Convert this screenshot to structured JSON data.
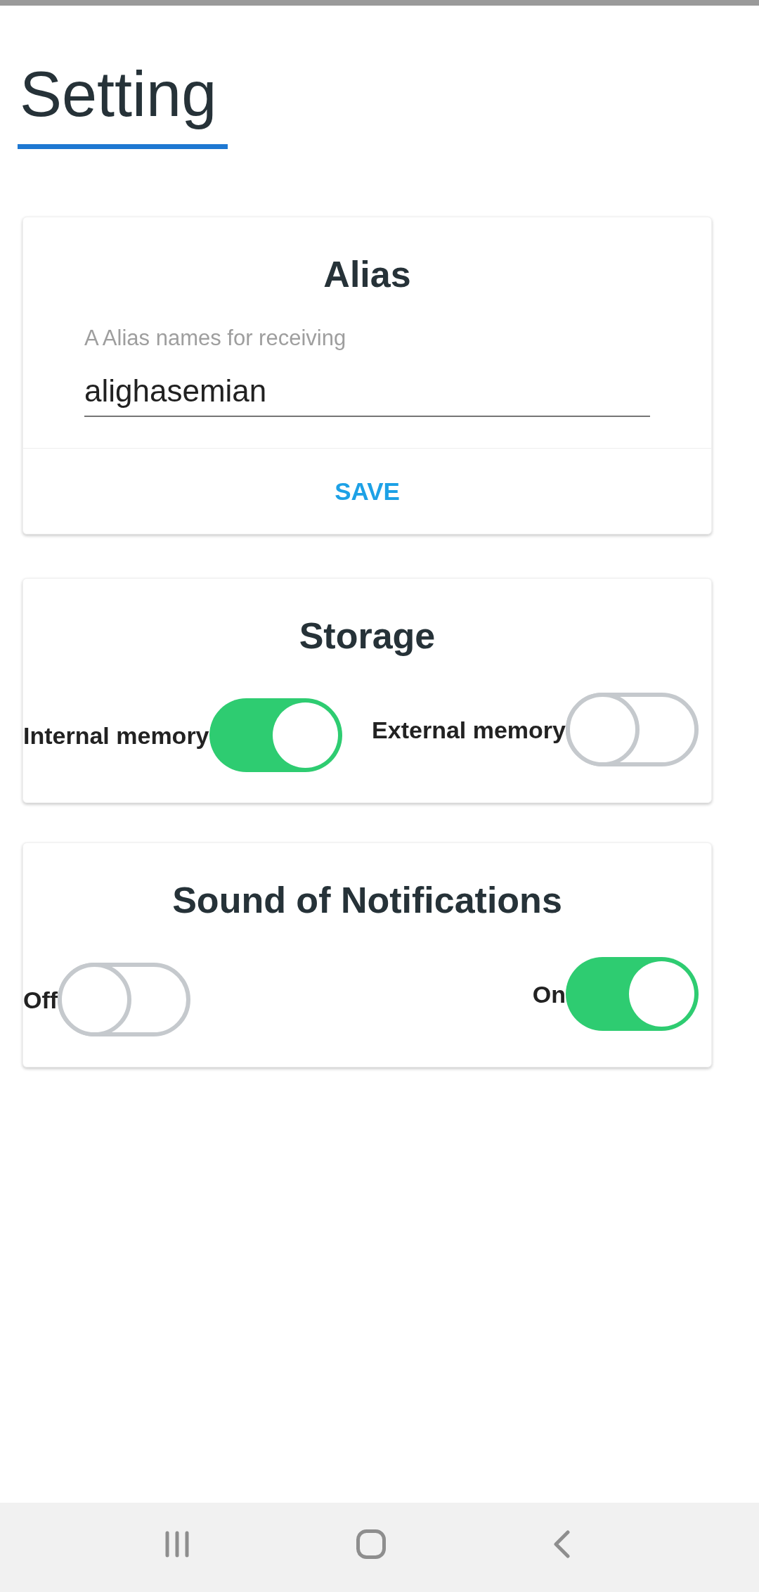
{
  "header": {
    "title": "Setting"
  },
  "alias_card": {
    "title": "Alias",
    "field": {
      "label": "A Alias names for receiving",
      "value": "alighasemian"
    },
    "save_button": "SAVE"
  },
  "storage_card": {
    "title": "Storage",
    "options": [
      {
        "label": "Internal memory",
        "on": true
      },
      {
        "label": "External memory",
        "on": false
      }
    ]
  },
  "notifications_card": {
    "title": "Sound of Notifications",
    "options": [
      {
        "label": "Off",
        "on": false
      },
      {
        "label": "On",
        "on": true
      }
    ]
  }
}
